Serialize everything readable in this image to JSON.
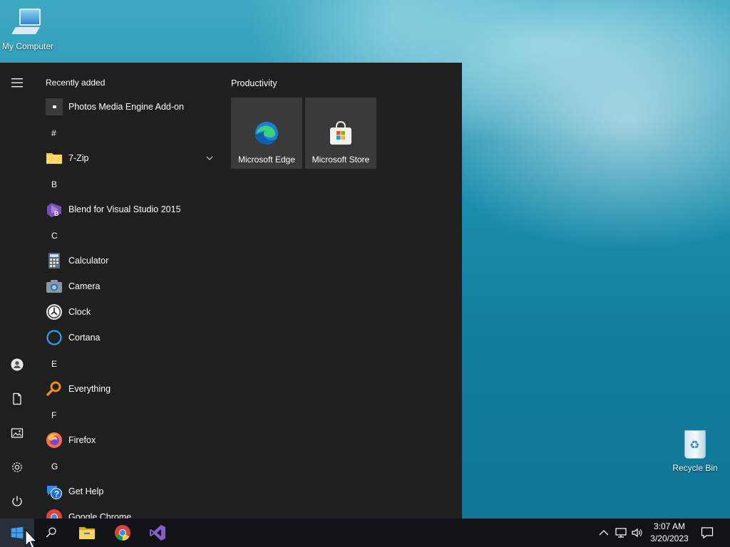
{
  "desktop": {
    "icons": [
      {
        "label": "My Computer"
      },
      {
        "label": "Recycle Bin"
      }
    ]
  },
  "start_menu": {
    "rail": [
      "menu-icon",
      "user-icon",
      "documents-icon",
      "pictures-icon",
      "settings-icon",
      "power-icon"
    ],
    "recently_added_title": "Recently added",
    "recent_apps": [
      {
        "label": "Photos Media Engine Add-on"
      }
    ],
    "letters": [
      "#",
      "B",
      "C",
      "E",
      "F",
      "G"
    ],
    "apps": {
      "hash": [
        {
          "label": "7-Zip"
        }
      ],
      "b": [
        {
          "label": "Blend for Visual Studio 2015"
        }
      ],
      "c": [
        {
          "label": "Calculator"
        },
        {
          "label": "Camera"
        },
        {
          "label": "Clock"
        },
        {
          "label": "Cortana"
        }
      ],
      "e": [
        {
          "label": "Everything"
        }
      ],
      "f": [
        {
          "label": "Firefox"
        }
      ],
      "g": [
        {
          "label": "Get Help"
        },
        {
          "label": "Google Chrome"
        }
      ]
    },
    "tiles_group_title": "Productivity",
    "tiles": [
      {
        "label": "Microsoft Edge"
      },
      {
        "label": "Microsoft Store"
      }
    ]
  },
  "taskbar": {
    "pinned": [
      "windows-start-icon",
      "search-icon",
      "file-explorer-icon",
      "chrome-icon",
      "visual-studio-icon"
    ],
    "tray": [
      "chevron-up-icon",
      "network-icon",
      "volume-icon",
      "action-center-icon"
    ],
    "time": "3:07 AM",
    "date": "3/20/2023"
  },
  "colors": {
    "menu_bg": "#1f1f1f",
    "tile_bg": "#3a3a3a",
    "taskbar_bg": "#101418"
  }
}
